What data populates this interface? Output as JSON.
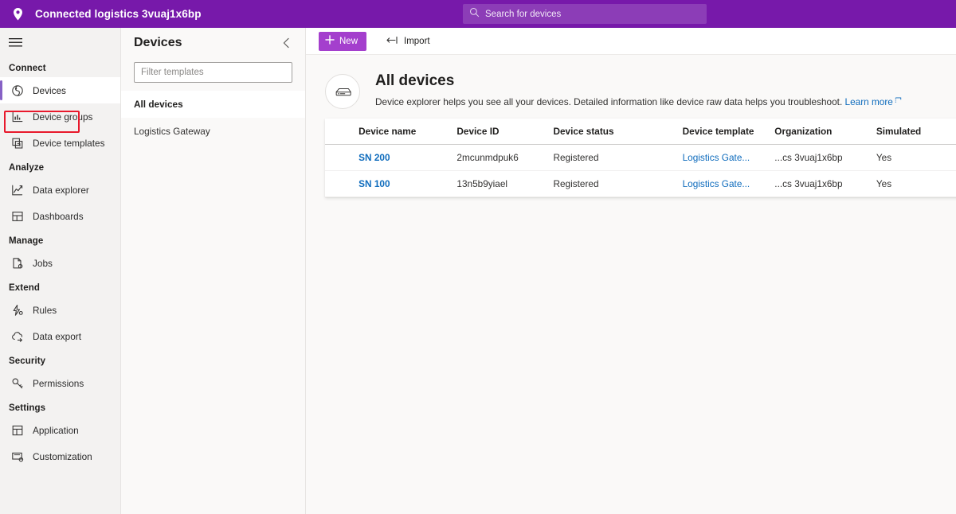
{
  "topbar": {
    "location_icon": "location-pin-icon",
    "title": "Connected logistics 3vuaj1x6bp",
    "search": {
      "icon": "search-icon",
      "placeholder": "Search for devices",
      "value": ""
    }
  },
  "rail": {
    "menu_icon": "hamburger-menu-icon",
    "groups": [
      {
        "label": "Connect",
        "items": [
          {
            "label": "Devices",
            "icon": "devices-icon",
            "selected": true,
            "highlighted": true
          },
          {
            "label": "Device groups",
            "icon": "device-groups-icon",
            "selected": false
          },
          {
            "label": "Device templates",
            "icon": "device-templates-icon",
            "selected": false
          }
        ]
      },
      {
        "label": "Analyze",
        "items": [
          {
            "label": "Data explorer",
            "icon": "data-explorer-icon",
            "selected": false
          },
          {
            "label": "Dashboards",
            "icon": "dashboards-icon",
            "selected": false
          }
        ]
      },
      {
        "label": "Manage",
        "items": [
          {
            "label": "Jobs",
            "icon": "jobs-icon",
            "selected": false
          }
        ]
      },
      {
        "label": "Extend",
        "items": [
          {
            "label": "Rules",
            "icon": "rules-icon",
            "selected": false
          },
          {
            "label": "Data export",
            "icon": "data-export-icon",
            "selected": false
          }
        ]
      },
      {
        "label": "Security",
        "items": [
          {
            "label": "Permissions",
            "icon": "key-icon",
            "selected": false
          }
        ]
      },
      {
        "label": "Settings",
        "items": [
          {
            "label": "Application",
            "icon": "application-icon",
            "selected": false
          },
          {
            "label": "Customization",
            "icon": "customization-icon",
            "selected": false
          }
        ]
      }
    ],
    "highlight_color": "#e8192c",
    "accent_color": "#8661c5"
  },
  "panel": {
    "title": "Devices",
    "collapse_icon": "chevron-left-icon",
    "filter": {
      "placeholder": "Filter templates",
      "value": ""
    },
    "items": [
      {
        "label": "All devices",
        "selected": true
      },
      {
        "label": "Logistics Gateway",
        "selected": false
      }
    ]
  },
  "toolbar": {
    "new_label": "New",
    "new_icon": "plus-icon",
    "import_label": "Import",
    "import_icon": "import-arrow-icon"
  },
  "page": {
    "icon": "device-hardware-icon",
    "title": "All devices",
    "description": "Device explorer helps you see all your devices. Detailed information like device raw data helps you troubleshoot.",
    "learn_more_label": "Learn more",
    "learn_more_icon": "external-link-icon"
  },
  "table": {
    "columns": [
      "Device name",
      "Device ID",
      "Device status",
      "Device template",
      "Organization",
      "Simulated"
    ],
    "rows": [
      {
        "device_name": "SN 200",
        "device_id": "2mcunmdpuk6",
        "device_status": "Registered",
        "device_template": "Logistics Gate...",
        "organization": "...cs 3vuaj1x6bp",
        "simulated": "Yes"
      },
      {
        "device_name": "SN 100",
        "device_id": "13n5b9yiael",
        "device_status": "Registered",
        "device_template": "Logistics Gate...",
        "organization": "...cs 3vuaj1x6bp",
        "simulated": "Yes"
      }
    ]
  },
  "colors": {
    "brand_purple": "#7719aa",
    "button_purple": "#a43fcd",
    "link_blue": "#0f6cbd",
    "annotation_red": "#e8192c"
  }
}
